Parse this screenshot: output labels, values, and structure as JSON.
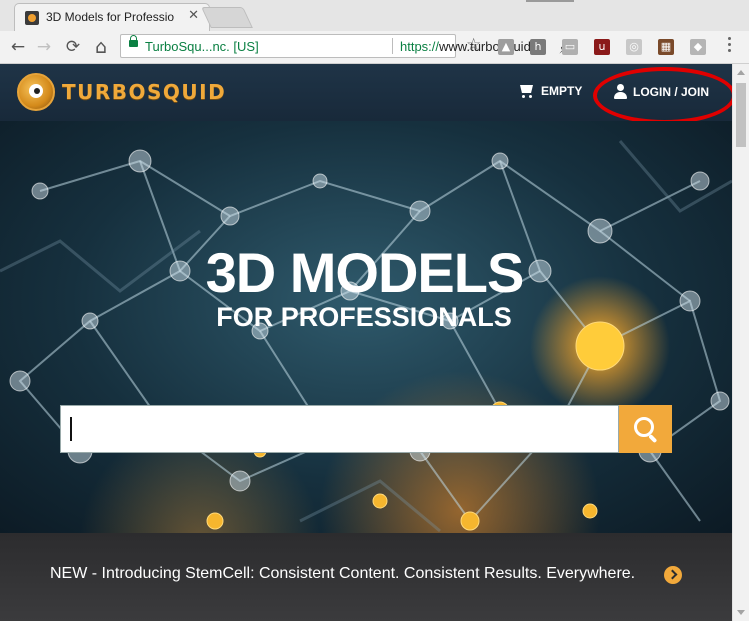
{
  "browser": {
    "tab": {
      "title": "3D Models for Professio",
      "close": "✕"
    },
    "nav": {
      "back": "←",
      "forward": "→",
      "reload": "⟳",
      "home": "⌂"
    },
    "omnibox": {
      "ev_label": "TurboSqu...nc. [US]",
      "url_scheme": "https://",
      "url_host": "www.turbosquid"
    },
    "extensions": [
      {
        "name": "drive-icon",
        "color": "#9e9e9e",
        "glyph": "▲"
      },
      {
        "name": "h-extension-icon",
        "color": "#7a7a7a",
        "glyph": "h"
      },
      {
        "name": "cast-extension-icon",
        "color": "#b0b0b0",
        "glyph": "▭"
      },
      {
        "name": "ublock-icon",
        "color": "#8b1a1a",
        "glyph": "u"
      },
      {
        "name": "swirl-extension-icon",
        "color": "#c8c8c8",
        "glyph": "◎"
      },
      {
        "name": "gift-extension-icon",
        "color": "#7a4a2a",
        "glyph": "▦"
      },
      {
        "name": "dropbox-icon",
        "color": "#b5b5b5",
        "glyph": "◆"
      }
    ]
  },
  "site": {
    "logo_text": "TurboSquid",
    "cart_label": "EMPTY",
    "login_label": "LOGIN / JOIN",
    "hero": {
      "title": "3D MODELS",
      "subtitle": "FOR PROFESSIONALS",
      "search_placeholder": ""
    },
    "promo_text": "NEW - Introducing StemCell: Consistent Content. Consistent Results. Everywhere.",
    "colors": {
      "accent": "#f2a93b",
      "header": "#1f3447",
      "annotation": "#e00000"
    }
  }
}
